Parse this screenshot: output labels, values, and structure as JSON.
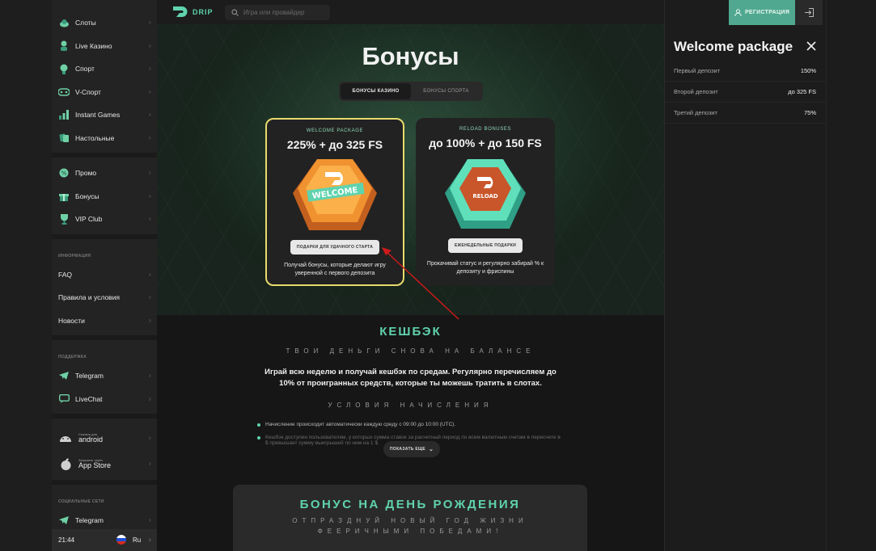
{
  "sidebar": {
    "main_items": [
      {
        "label": "Слоты",
        "icon": "slots-icon"
      },
      {
        "label": "Live Казино",
        "icon": "live-casino-icon"
      },
      {
        "label": "Спорт",
        "icon": "sport-icon"
      },
      {
        "label": "V-Спорт",
        "icon": "vsport-icon"
      },
      {
        "label": "Instant Games",
        "icon": "instant-games-icon"
      },
      {
        "label": "Настольные",
        "icon": "table-games-icon"
      }
    ],
    "promo_items": [
      {
        "label": "Промо",
        "icon": "promo-icon"
      },
      {
        "label": "Бонусы",
        "icon": "gift-icon"
      },
      {
        "label": "VIP Club",
        "icon": "trophy-icon"
      }
    ],
    "info_section": "ИНФОРМАЦИЯ",
    "info_items": [
      "FAQ",
      "Правила и условия",
      "Новости"
    ],
    "support_section": "ПОДДЕРЖКА",
    "support_items": [
      {
        "label": "Telegram",
        "icon": "telegram-icon"
      },
      {
        "label": "LiveChat",
        "icon": "chat-icon"
      }
    ],
    "stores": [
      {
        "small": "Скачать для",
        "big": "android"
      },
      {
        "small": "Загрузить через",
        "big": "App Store"
      }
    ],
    "social_section": "СОЦИАЛЬНЫЕ СЕТИ",
    "social_items": [
      {
        "label": "Telegram"
      }
    ],
    "footer": {
      "time": "21:44",
      "lang": "Ru"
    }
  },
  "header": {
    "logo_text": "DRIP",
    "search_placeholder": "Игра или провайдер",
    "register_label": "РЕГИСТРАЦИЯ"
  },
  "page": {
    "title": "Бонусы",
    "tabs": [
      {
        "label": "БОНУСЫ КАЗИНО",
        "active": true
      },
      {
        "label": "БОНУСЫ СПОРТА",
        "active": false
      }
    ],
    "cards": [
      {
        "eyebrow": "WELCOME PACKAGE",
        "headline": "225% + до 325 FS",
        "badge_text": "WELCOME",
        "button": "ПОДАРКИ ДЛЯ УДАЧНОГО СТАРТА",
        "desc": "Получай бонусы, которые делают игру уверенной с первого депозита"
      },
      {
        "eyebrow": "RELOAD BONUSES",
        "headline": "до 100% + до 150 FS",
        "badge_text": "RELOAD",
        "button": "ЕЖЕНЕДЕЛЬНЫЕ ПОДАРКИ",
        "desc": "Прокачивай статус и регулярно забирай % к депозиту и фриспины"
      }
    ],
    "cashback": {
      "title": "КЕШБЭК",
      "subtitle": "ТВОИ ДЕНЬГИ СНОВА НА БАЛАНСЕ",
      "text": "Играй всю неделю и получай кешбэк по средам. Регулярно перечисляем до 10% от проигранных средств, которые ты можешь тратить в слотах.",
      "conditions_title": "УСЛОВИЯ НАЧИСЛЕНИЯ",
      "conditions": [
        "Начисление происходит автоматически каждую среду с 09:00 до 10:00 (UTC).",
        "Кешбэк доступен пользователям, у которых сумма ставок за расчетный период по всем валютным счетам в пересчете в $ превышает сумму выигрышей по ним на 1 $."
      ],
      "show_more": "ПОКАЗАТЬ ЕЩЕ"
    },
    "birthday": {
      "title": "БОНУС НА ДЕНЬ РОЖДЕНИЯ",
      "subtitle": "ОТПРАЗДНУЙ НОВЫЙ ГОД ЖИЗНИ ФЕЕРИЧНЫМИ ПОБЕДАМИ!"
    }
  },
  "panel": {
    "title": "Welcome package",
    "rows": [
      {
        "k": "Первый депозит",
        "v": "150%"
      },
      {
        "k": "Второй депозит",
        "v": "до 325 FS"
      },
      {
        "k": "Третий депозит",
        "v": "75%"
      }
    ]
  },
  "colors": {
    "accent": "#5fd3ae",
    "card_highlight": "#e7db6b",
    "register_bg": "#4fa88f",
    "arrow": "#d11a1a"
  }
}
